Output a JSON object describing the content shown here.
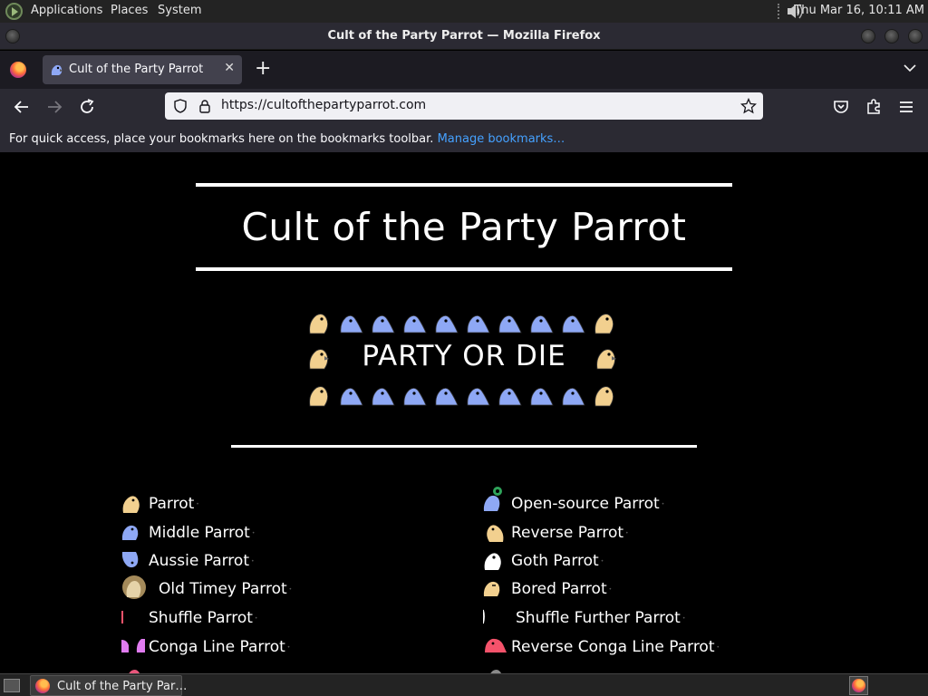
{
  "top_panel": {
    "menus": [
      "Applications",
      "Places",
      "System"
    ],
    "clock": "Thu Mar 16, 10:11 AM",
    "icons": [
      "distro-logo-icon",
      "sound-icon"
    ]
  },
  "window": {
    "title": "Cult of the Party Parrot — Mozilla Firefox"
  },
  "tabs": [
    {
      "label": "Cult of the Party Parrot",
      "icon": "parrot-favicon-icon",
      "active": true
    }
  ],
  "toolbar": {
    "new_tab": "+",
    "close_tab": "✕",
    "url": "https://cultofthepartyparrot.com"
  },
  "bookmarks_bar": {
    "message": "For quick access, place your bookmarks here on the bookmarks toolbar.",
    "link": "Manage bookmarks…"
  },
  "page": {
    "title": "Cult of the Party Parrot",
    "banner": "PARTY OR DIE",
    "colors": {
      "background": "#000000",
      "text": "#ffffff",
      "gold_parrot": "#f2d08f",
      "blue_parrot": "#8ea8f5"
    },
    "banner_rows": {
      "top": [
        "gold",
        "blue",
        "blue",
        "blue",
        "blue",
        "blue",
        "blue",
        "blue",
        "blue",
        "gold"
      ],
      "bottom": [
        "gold",
        "blue",
        "blue",
        "blue",
        "blue",
        "blue",
        "blue",
        "blue",
        "blue",
        "gold"
      ]
    },
    "left_list": [
      {
        "label": "Parrot",
        "icon": "parrot-icon"
      },
      {
        "label": "Middle Parrot",
        "icon": "middle-parrot-icon"
      },
      {
        "label": "Aussie Parrot",
        "icon": "aussie-parrot-icon"
      },
      {
        "label": "Old Timey Parrot",
        "icon": "old-timey-parrot-icon"
      },
      {
        "label": "Shuffle Parrot",
        "icon": "shuffle-parrot-icon"
      },
      {
        "label": "Conga Line Parrot",
        "icon": "conga-line-parrot-icon"
      }
    ],
    "right_list": [
      {
        "label": "Open-source Parrot",
        "icon": "open-source-parrot-icon"
      },
      {
        "label": "Reverse Parrot",
        "icon": "reverse-parrot-icon"
      },
      {
        "label": "Goth Parrot",
        "icon": "goth-parrot-icon"
      },
      {
        "label": "Bored Parrot",
        "icon": "bored-parrot-icon"
      },
      {
        "label": "Shuffle Further Parrot",
        "icon": "shuffle-further-parrot-icon"
      },
      {
        "label": "Reverse Conga Line Parrot",
        "icon": "reverse-conga-line-parrot-icon"
      }
    ]
  },
  "taskbar": {
    "task_label": "Cult of the Party Par…"
  }
}
